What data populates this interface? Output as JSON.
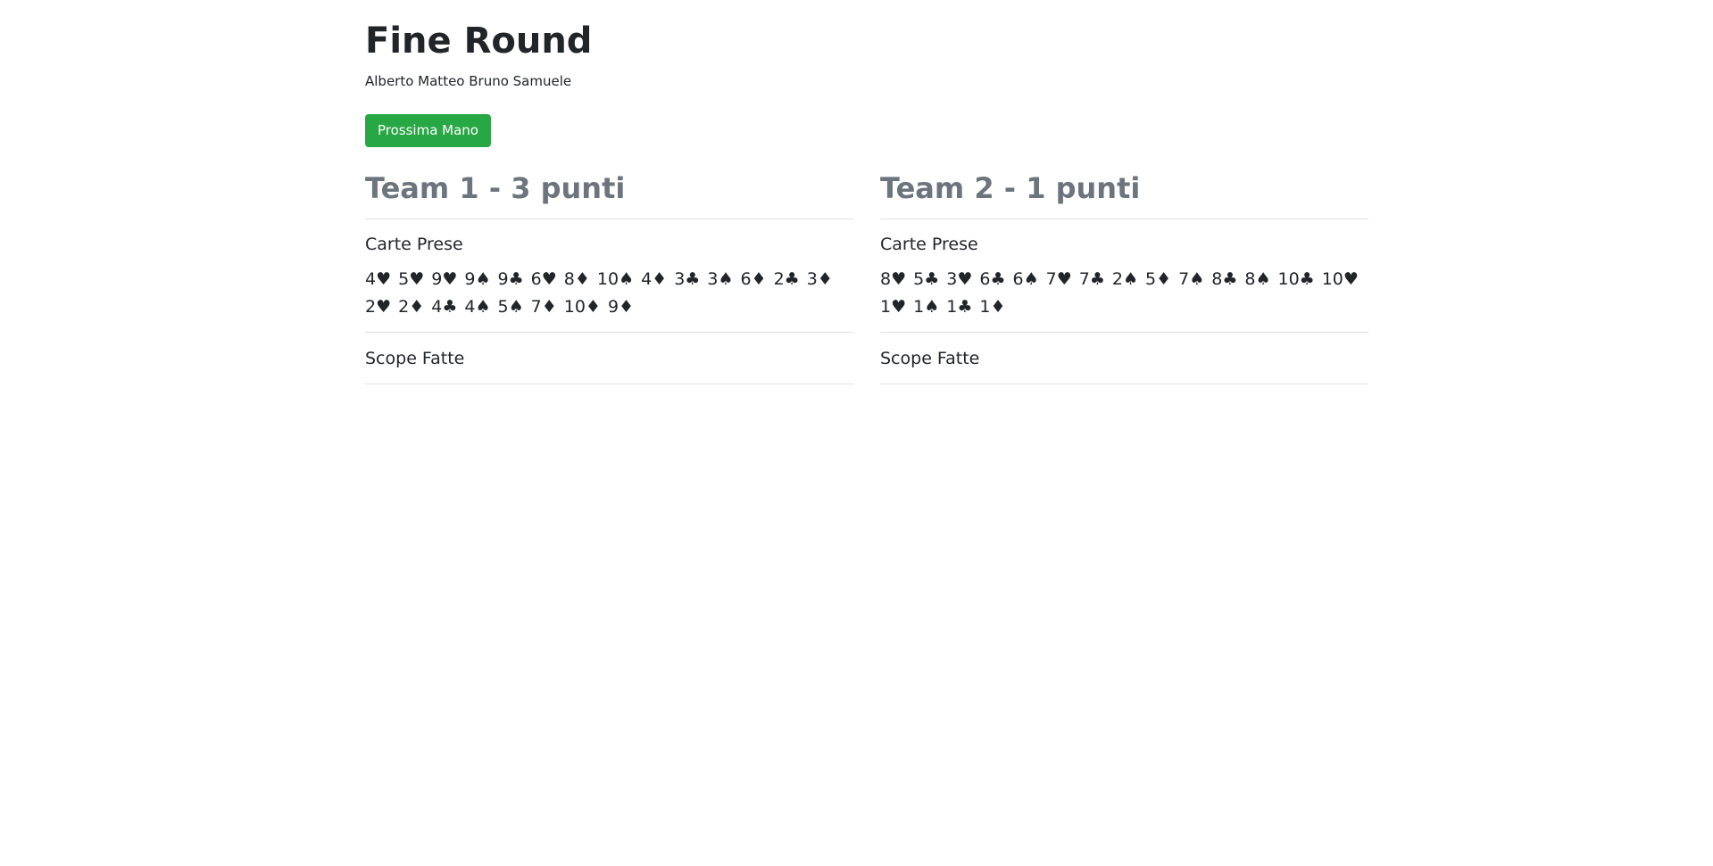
{
  "page": {
    "title": "Fine Round",
    "players": "Alberto Matteo Bruno Samuele"
  },
  "actions": {
    "next_hand_label": "Prossima Mano"
  },
  "teams": [
    {
      "header": "Team 1 - 3 punti",
      "captured_label": "Carte Prese",
      "cards": [
        "4♥",
        "5♥",
        "9♥",
        "9♠",
        "9♣",
        "6♥",
        "8♦",
        "10♠",
        "4♦",
        "3♣",
        "3♠",
        "6♦",
        "2♣",
        "3♦",
        "2♥",
        "2♦",
        "4♣",
        "4♠",
        "5♠",
        "7♦",
        "10♦",
        "9♦"
      ],
      "scope_label": "Scope Fatte"
    },
    {
      "header": "Team 2 - 1 punti",
      "captured_label": "Carte Prese",
      "cards": [
        "8♥",
        "5♣",
        "3♥",
        "6♣",
        "6♠",
        "7♥",
        "7♣",
        "2♠",
        "5♦",
        "7♠",
        "8♣",
        "8♠",
        "10♣",
        "10♥",
        "1♥",
        "1♠",
        "1♣",
        "1♦"
      ],
      "scope_label": "Scope Fatte"
    }
  ],
  "colors": {
    "button_green": "#28a745",
    "header_gray": "#6c757d",
    "text": "#212529",
    "divider": "#dee2e6"
  }
}
